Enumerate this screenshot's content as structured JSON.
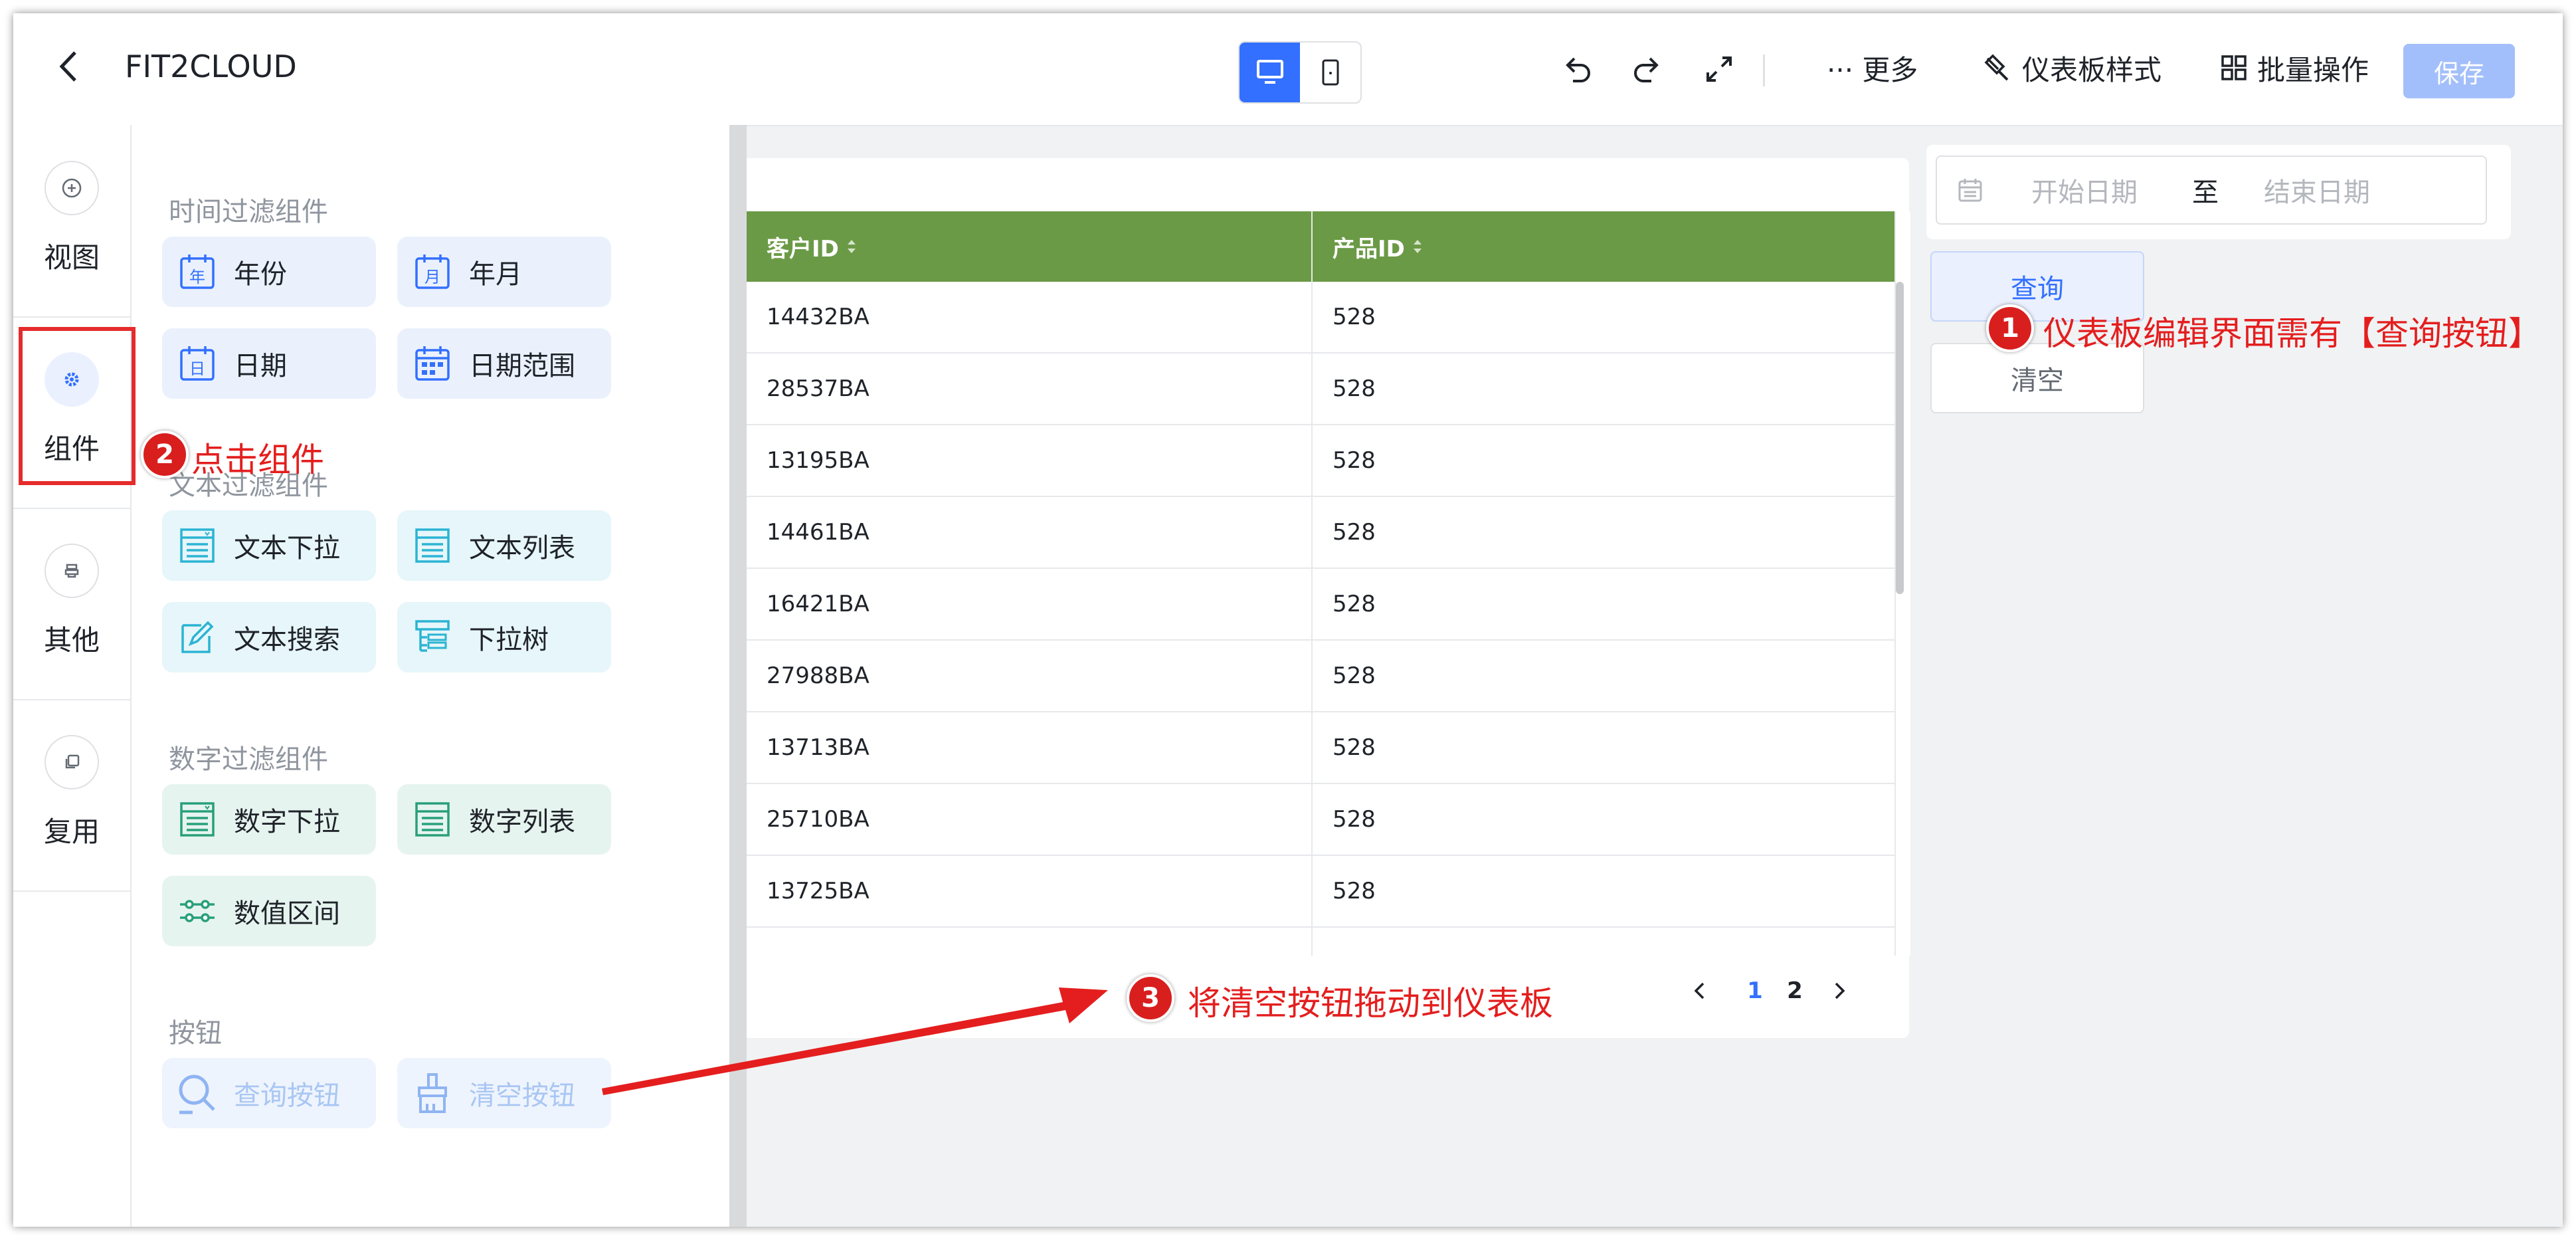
{
  "topbar": {
    "title": "FIT2CLOUD",
    "more_label": "··· 更多",
    "dashboard_style_label": "仪表板样式",
    "batch_label": "批量操作",
    "save_label": "保存"
  },
  "rail": {
    "items": [
      {
        "label": "视图",
        "icon": "plus-circle-icon"
      },
      {
        "label": "组件",
        "icon": "gear-icon"
      },
      {
        "label": "其他",
        "icon": "stamp-icon"
      },
      {
        "label": "复用",
        "icon": "copy-icon"
      }
    ]
  },
  "panel": {
    "groups": [
      {
        "title": "时间过滤组件",
        "chips": [
          "年份",
          "年月",
          "日期",
          "日期范围"
        ]
      },
      {
        "title": "文本过滤组件",
        "chips": [
          "文本下拉",
          "文本列表",
          "文本搜索",
          "下拉树"
        ]
      },
      {
        "title": "数字过滤组件",
        "chips": [
          "数字下拉",
          "数字列表",
          "数值区间"
        ]
      },
      {
        "title": "按钮",
        "chips": [
          "查询按钮",
          "清空按钮"
        ]
      }
    ]
  },
  "table": {
    "headers": [
      "客户ID",
      "产品ID"
    ],
    "rows": [
      [
        "14432BA",
        "528"
      ],
      [
        "28537BA",
        "528"
      ],
      [
        "13195BA",
        "528"
      ],
      [
        "14461BA",
        "528"
      ],
      [
        "16421BA",
        "528"
      ],
      [
        "27988BA",
        "528"
      ],
      [
        "13713BA",
        "528"
      ],
      [
        "25710BA",
        "528"
      ],
      [
        "13725BA",
        "528"
      ]
    ],
    "pages": [
      "1",
      "2"
    ],
    "current_page": "1"
  },
  "filter": {
    "start_placeholder": "开始日期",
    "separator": "至",
    "end_placeholder": "结束日期",
    "query_label": "查询",
    "clear_label": "清空"
  },
  "annotations": [
    {
      "num": "1",
      "text": "仪表板编辑界面需有【查询按钮】"
    },
    {
      "num": "2",
      "text": "点击组件"
    },
    {
      "num": "3",
      "text": "将清空按钮拖动到仪表板"
    }
  ],
  "colors": {
    "accent": "#3370ff",
    "table_header": "#6b9a46",
    "annotation_red": "#e41e1e"
  }
}
